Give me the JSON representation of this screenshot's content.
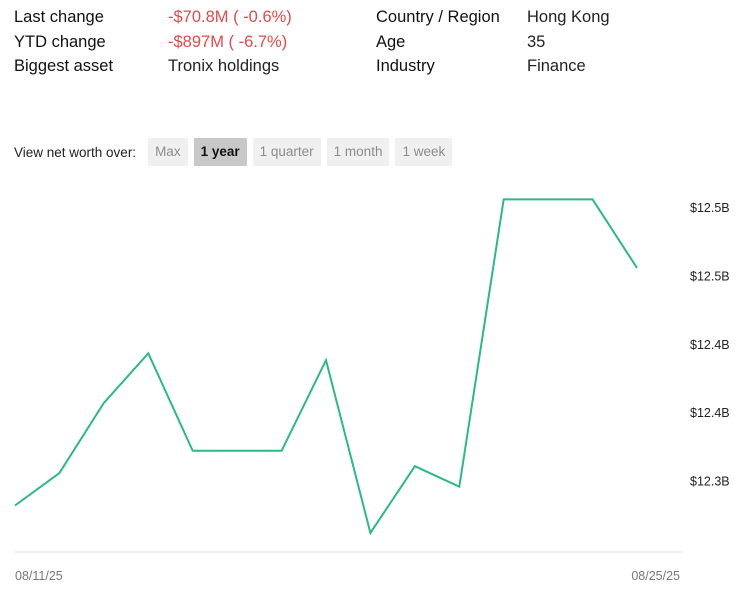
{
  "stats": {
    "last_change_label": "Last change",
    "last_change_value": "-$70.8M ( -0.6%)",
    "ytd_change_label": "YTD change",
    "ytd_change_value": "-$897M ( -6.7%)",
    "biggest_asset_label": "Biggest asset",
    "biggest_asset_value": "Tronix holdings",
    "country_label": "Country / Region",
    "country_value": "Hong Kong",
    "age_label": "Age",
    "age_value": "35",
    "industry_label": "Industry",
    "industry_value": "Finance",
    "negative_color": "#e24a4a"
  },
  "range": {
    "label": "View net worth over:",
    "options": [
      "Max",
      "1 year",
      "1 quarter",
      "1 month",
      "1 week"
    ],
    "active": "1 year"
  },
  "chart_data": {
    "type": "line",
    "line_color": "#2bb88a",
    "x_tick_labels": [
      "08/11/25",
      "08/25/25"
    ],
    "y_tick_labels": [
      "$12.5B",
      "$12.5B",
      "$12.4B",
      "$12.4B",
      "$12.3B"
    ],
    "y_tick_values": [
      12.52,
      12.48,
      12.44,
      12.4,
      12.36
    ],
    "ylim": [
      12.32,
      12.52
    ],
    "series": [
      {
        "values": [
          12.346,
          12.365,
          12.406,
          12.435,
          12.378,
          12.378,
          12.378,
          12.431,
          12.33,
          12.369,
          12.357,
          12.525,
          12.525,
          12.525,
          12.485
        ]
      }
    ],
    "grid": false
  }
}
